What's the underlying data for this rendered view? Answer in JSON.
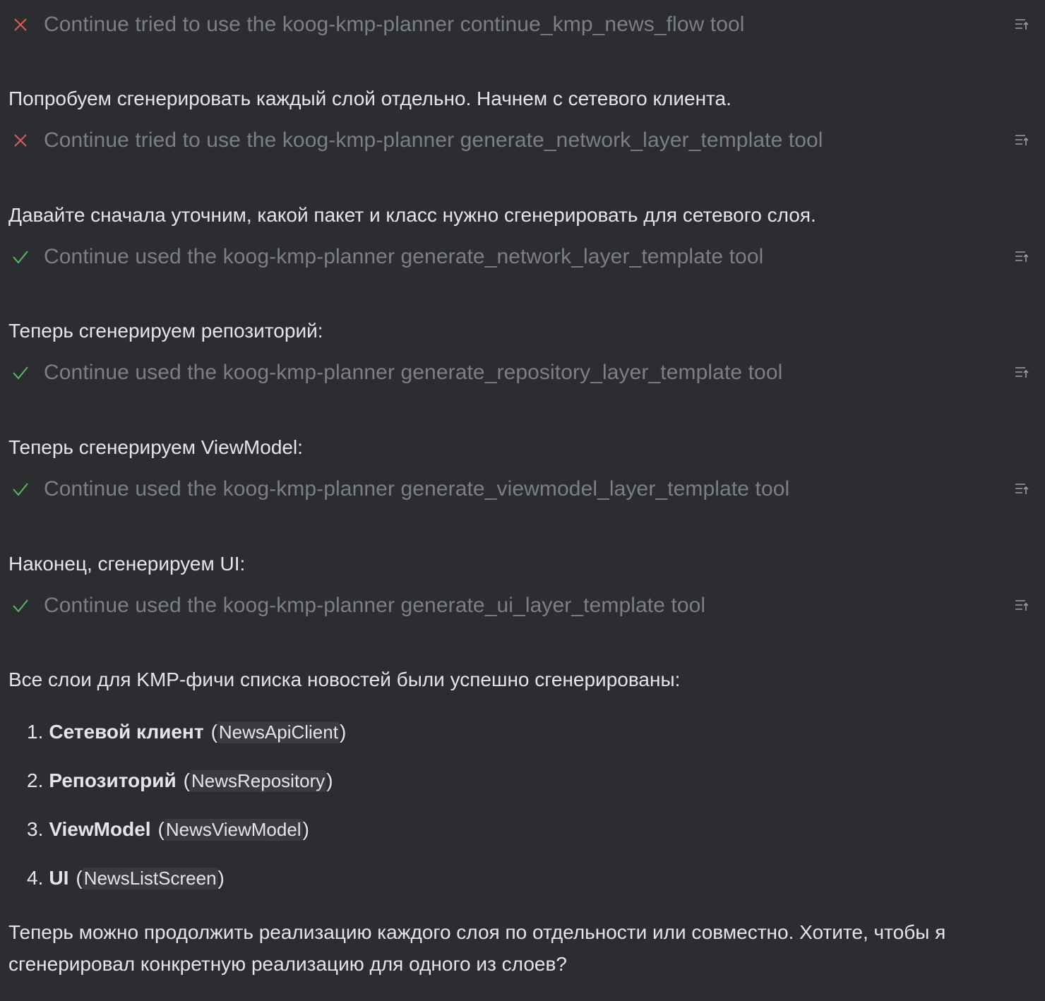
{
  "tool_calls": [
    {
      "status": "error",
      "text": "Continue tried to use the koog-kmp-planner continue_kmp_news_flow tool"
    },
    {
      "status": "error",
      "text": "Continue tried to use the koog-kmp-planner generate_network_layer_template tool"
    },
    {
      "status": "success",
      "text": "Continue used the koog-kmp-planner generate_network_layer_template tool"
    },
    {
      "status": "success",
      "text": "Continue used the koog-kmp-planner generate_repository_layer_template tool"
    },
    {
      "status": "success",
      "text": "Continue used the koog-kmp-planner generate_viewmodel_layer_template tool"
    },
    {
      "status": "success",
      "text": "Continue used the koog-kmp-planner generate_ui_layer_template tool"
    }
  ],
  "messages": [
    "Попробуем сгенерировать каждый слой отдельно. Начнем с сетевого клиента.",
    "Давайте сначала уточним, какой пакет и класс нужно сгенерировать для сетевого слоя.",
    "Теперь сгенерируем репозиторий:",
    "Теперь сгенерируем ViewModel:",
    "Наконец, сгенерируем UI:",
    "Все слои для KMP-фичи списка новостей были успешно сгенерированы:"
  ],
  "summary_list": [
    {
      "num": "1.",
      "title": "Сетевой клиент",
      "code": "NewsApiClient"
    },
    {
      "num": "2.",
      "title": "Репозиторий",
      "code": "NewsRepository"
    },
    {
      "num": "3.",
      "title": "ViewModel",
      "code": "NewsViewModel"
    },
    {
      "num": "4.",
      "title": "UI",
      "code": "NewsListScreen"
    }
  ],
  "final_message": "Теперь можно продолжить реализацию каждого слоя по отдельности или совместно. Хотите, чтобы я сгенерировал конкретную реализацию для одного из слоев?",
  "colors": {
    "background": "#2b2d30",
    "error_icon": "#db5c5c",
    "success_icon": "#5fb865",
    "tool_text": "#7c7f85",
    "body_text": "#e4e5e8"
  },
  "icons": {
    "error": "close-icon",
    "success": "check-icon",
    "expand": "expand-details-icon"
  }
}
